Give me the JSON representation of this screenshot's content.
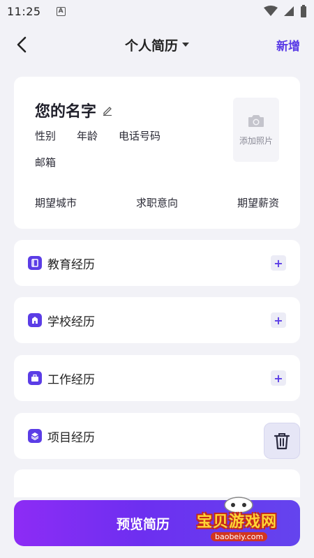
{
  "status_bar": {
    "time": "11:25",
    "badge_icon": "a-badge-icon",
    "wifi_icon": "wifi-icon",
    "signal_icon": "signal-icon",
    "battery_icon": "battery-icon"
  },
  "header": {
    "title": "个人简历",
    "add_label": "新增"
  },
  "profile": {
    "name": "您的名字",
    "gender": "性别",
    "age": "年龄",
    "phone": "电话号码",
    "email": "邮箱",
    "photo_label": "添加照片",
    "expected_city": "期望城市",
    "job_intention": "求职意向",
    "expected_salary": "期望薪资"
  },
  "sections": [
    {
      "label": "教育经历",
      "icon": "book-icon"
    },
    {
      "label": "学校经历",
      "icon": "school-icon"
    },
    {
      "label": "工作经历",
      "icon": "briefcase-icon"
    },
    {
      "label": "项目经历",
      "icon": "layers-icon"
    }
  ],
  "preview_label": "预览简历",
  "watermark": {
    "text": "宝贝游戏网",
    "url": "baobeiy.com"
  },
  "colors": {
    "accent": "#5b3de6",
    "background": "#f2f2f7",
    "button_gradient_start": "#8d2cf5",
    "button_gradient_end": "#6444ee"
  }
}
